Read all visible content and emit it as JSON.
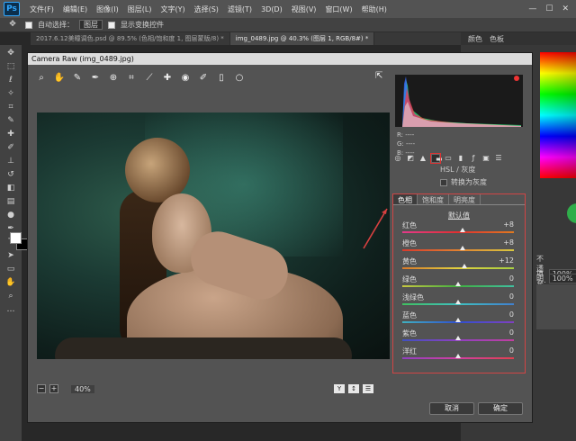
{
  "menubar": {
    "logo": "Ps",
    "items": [
      "文件(F)",
      "编辑(E)",
      "图像(I)",
      "图层(L)",
      "文字(Y)",
      "选择(S)",
      "滤镜(T)",
      "3D(D)",
      "视图(V)",
      "窗口(W)",
      "帮助(H)"
    ],
    "window_controls": [
      "—",
      "☐",
      "✕"
    ]
  },
  "options": {
    "auto_select_label": "自动选择：",
    "auto_select_value": "图层",
    "show_transform_label": "显示变换控件"
  },
  "doc_tabs": [
    {
      "label": "2017.6.12美瞳调色.psd @ 89.5% (色相/饱和度 1, 图层蒙版/8) *",
      "active": false
    },
    {
      "label": "img_0489.jpg @ 40.3% (图层 1, RGB/8#) *",
      "active": true
    }
  ],
  "right_panel": {
    "tabs": [
      "颜色",
      "色板"
    ],
    "opacity_label": "不透明度:",
    "opacity_value": "100%",
    "fill_label": "填充:",
    "fill_value": "100%"
  },
  "dialog": {
    "title": "Camera Raw (img_0489.jpg)",
    "zoom_value": "40%",
    "zoom_minus": "−",
    "zoom_plus": "+",
    "view_buttons": [
      "Y",
      "↕",
      "☰"
    ],
    "rgb_readout": [
      "R:  ----",
      "G:  ----",
      "B:  ----"
    ],
    "hsl_title": "HSL / 灰度",
    "convert_gray_label": "转换为灰度",
    "hsl_tabs": [
      "色相",
      "饱和度",
      "明亮度"
    ],
    "default_link": "默认值",
    "sliders": [
      {
        "label": "红色",
        "value": "+8",
        "num": 8,
        "colors": [
          "#e23a8a",
          "#e03030",
          "#e07a20"
        ]
      },
      {
        "label": "橙色",
        "value": "+8",
        "num": 8,
        "colors": [
          "#d83a2c",
          "#e08030",
          "#d8c840"
        ]
      },
      {
        "label": "黄色",
        "value": "+12",
        "num": 12,
        "colors": [
          "#d87a2a",
          "#e0d040",
          "#a8d040"
        ]
      },
      {
        "label": "绿色",
        "value": "0",
        "num": 0,
        "colors": [
          "#c8c840",
          "#40b040",
          "#40c0a0"
        ]
      },
      {
        "label": "浅绿色",
        "value": "0",
        "num": 0,
        "colors": [
          "#40c060",
          "#40c0c0",
          "#4080d0"
        ]
      },
      {
        "label": "蓝色",
        "value": "0",
        "num": 0,
        "colors": [
          "#40b0c0",
          "#3050d0",
          "#8040c0"
        ]
      },
      {
        "label": "紫色",
        "value": "0",
        "num": 0,
        "colors": [
          "#4050c0",
          "#9040c0",
          "#c040a0"
        ]
      },
      {
        "label": "洋红",
        "value": "0",
        "num": 0,
        "colors": [
          "#9040c0",
          "#d040a0",
          "#e04050"
        ]
      }
    ],
    "cancel_label": "取消",
    "ok_label": "确定"
  }
}
